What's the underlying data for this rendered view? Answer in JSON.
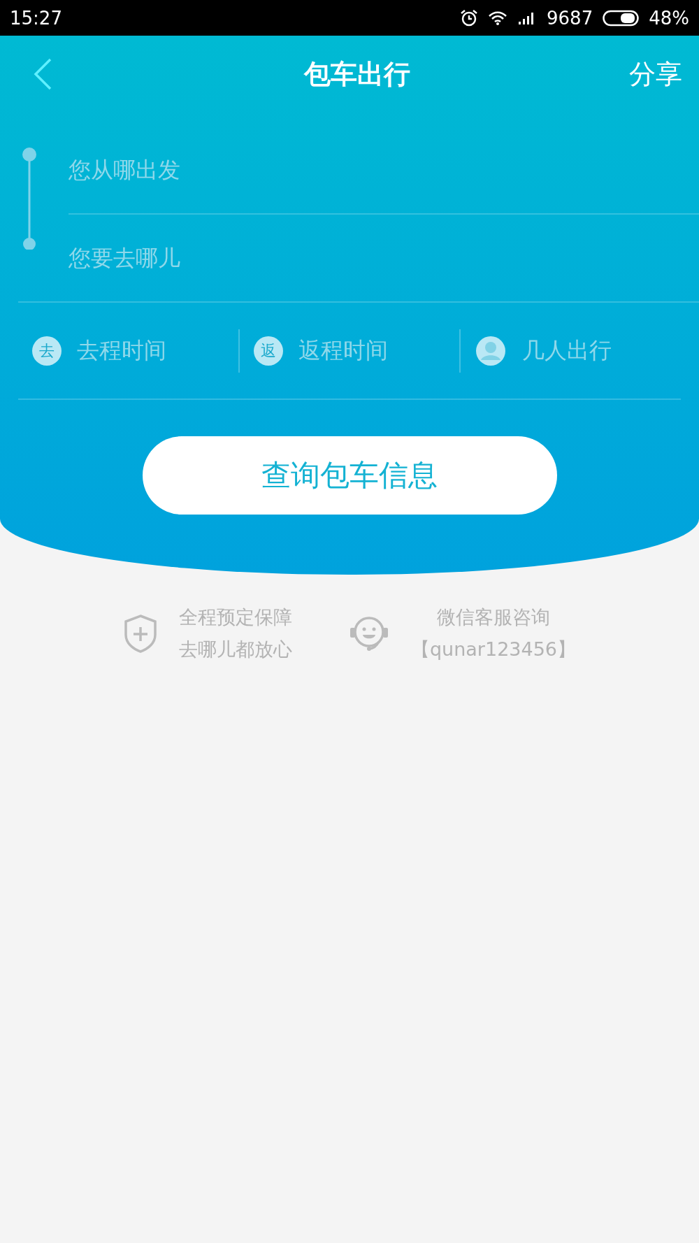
{
  "status_bar": {
    "time": "15:27",
    "network_speed": "9687",
    "battery": "48%"
  },
  "nav": {
    "title": "包车出行",
    "share": "分享"
  },
  "route": {
    "from_placeholder": "您从哪出发",
    "to_placeholder": "您要去哪儿"
  },
  "options": [
    {
      "kind": "badge",
      "badge": "去",
      "label": "去程时间"
    },
    {
      "kind": "badge",
      "badge": "返",
      "label": "返程时间"
    },
    {
      "kind": "person",
      "label": "几人出行"
    }
  ],
  "search_button": "查询包车信息",
  "features": [
    {
      "kind": "shield",
      "lines": [
        "全程预定保障",
        "去哪儿都放心"
      ]
    },
    {
      "kind": "support",
      "lines": [
        "微信客服咨询",
        "【qunar123456】"
      ]
    }
  ]
}
